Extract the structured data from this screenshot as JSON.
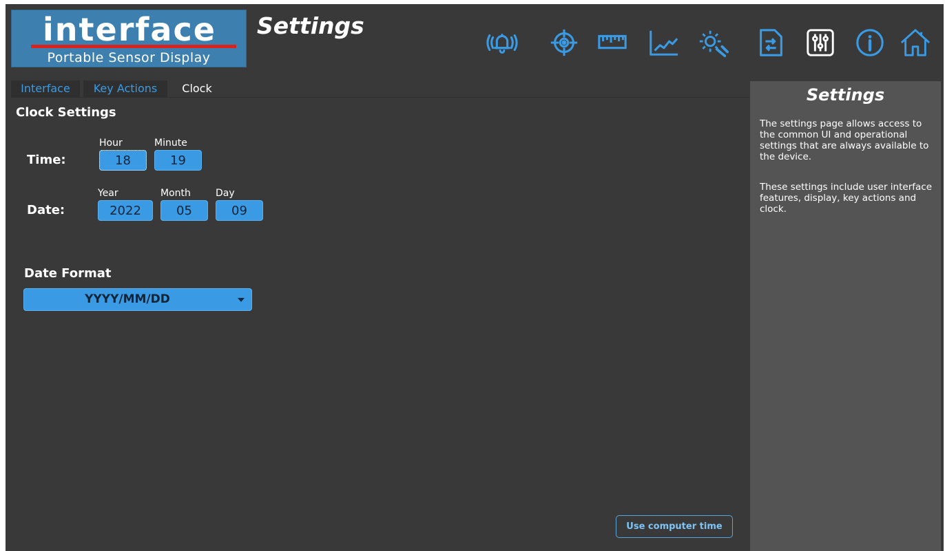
{
  "header": {
    "logo_word": "interface",
    "logo_sub": "Portable Sensor Display",
    "title": "Settings"
  },
  "toolbar": {
    "icons": [
      "alarm-icon",
      "target-icon",
      "ruler-icon",
      "chart-icon",
      "gear-wrench-icon",
      "file-transfer-icon",
      "sliders-icon",
      "info-icon",
      "home-icon"
    ],
    "accent_color": "#3a9be4",
    "active_color": "#ffffff"
  },
  "tabs": [
    {
      "label": "Interface",
      "active": false
    },
    {
      "label": "Key Actions",
      "active": false
    },
    {
      "label": "Clock",
      "active": true
    }
  ],
  "clock": {
    "section_title": "Clock Settings",
    "time_label": "Time:",
    "hour_label": "Hour",
    "hour_value": "18",
    "minute_label": "Minute",
    "minute_value": "19",
    "date_label": "Date:",
    "year_label": "Year",
    "year_value": "2022",
    "month_label": "Month",
    "month_value": "05",
    "day_label": "Day",
    "day_value": "09",
    "date_format_label": "Date Format",
    "date_format_value": "YYYY/MM/DD",
    "use_computer_time_label": "Use computer time"
  },
  "help": {
    "title": "Settings",
    "paragraph1": "The settings page allows access to the common UI and operational settings that are always available to the device.",
    "paragraph2": "These settings include user interface features, display, key actions and clock."
  }
}
